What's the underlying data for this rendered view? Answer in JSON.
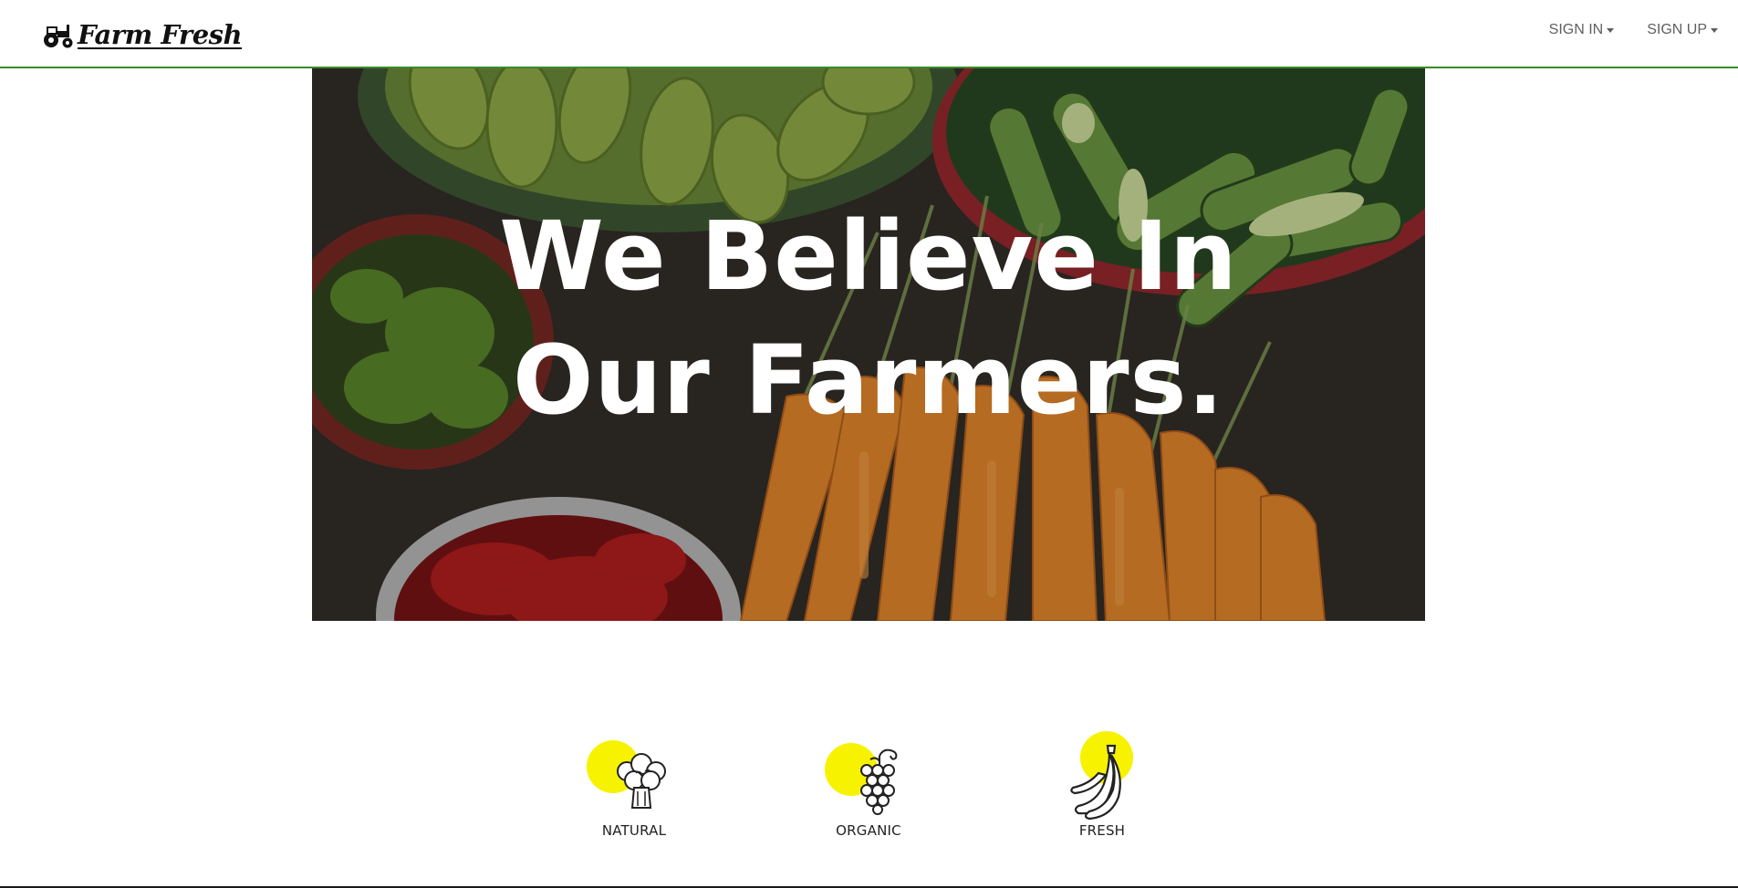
{
  "brand": {
    "name": "Farm Fresh",
    "icon": "tractor-icon",
    "accent_color": "#3b8a2a"
  },
  "nav": {
    "items": [
      {
        "label": "SIGN IN",
        "icon": "caret-down-icon"
      },
      {
        "label": "SIGN UP",
        "icon": "caret-down-icon"
      }
    ]
  },
  "hero": {
    "line1": "We Believe In",
    "line2": "Our Farmers.",
    "image": "vegetables-market-photo"
  },
  "features": [
    {
      "label": "NATURAL",
      "icon": "broccoli-icon",
      "color": "#f7f200"
    },
    {
      "label": "ORGANIC",
      "icon": "grapes-icon",
      "color": "#f7f200"
    },
    {
      "label": "FRESH",
      "icon": "banana-icon",
      "color": "#f7f200"
    }
  ]
}
